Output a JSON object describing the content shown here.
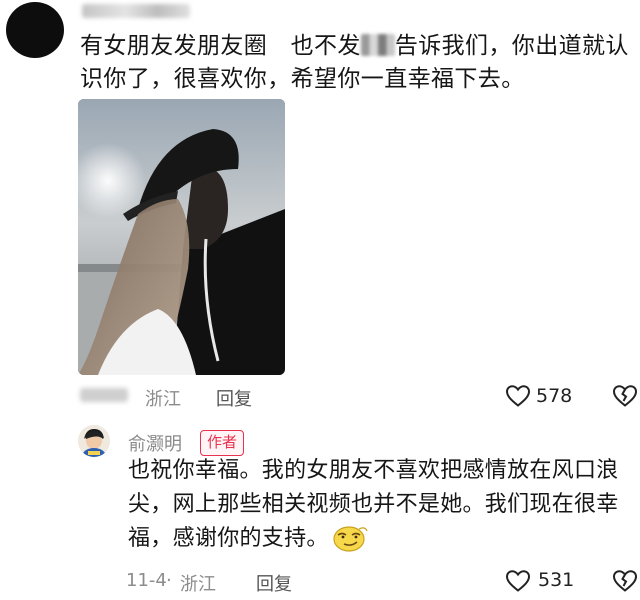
{
  "comment": {
    "text_before": "有女朋友发朋友圈　也不发",
    "text_after": "告诉我们，你出道就认识你了，很喜欢你，希望你一直幸福下去。",
    "location": "浙江",
    "reply_label": "回复",
    "likes": "578"
  },
  "reply": {
    "username": "俞灏明",
    "badge": "作者",
    "text": "也祝你幸福。我的女朋友不喜欢把感情放在风口浪尖，网上那些相关视频也并不是她。我们现在很幸福，感谢你的支持。",
    "date": "11-4",
    "location": "浙江",
    "reply_label": "回复",
    "likes": "531"
  },
  "icons": {
    "like": "heart-outline-icon",
    "dislike": "broken-heart-icon",
    "emoji": "smirk-emoji-icon"
  },
  "colors": {
    "badge": "#e8324f",
    "meta_text": "#8c8c8c"
  }
}
